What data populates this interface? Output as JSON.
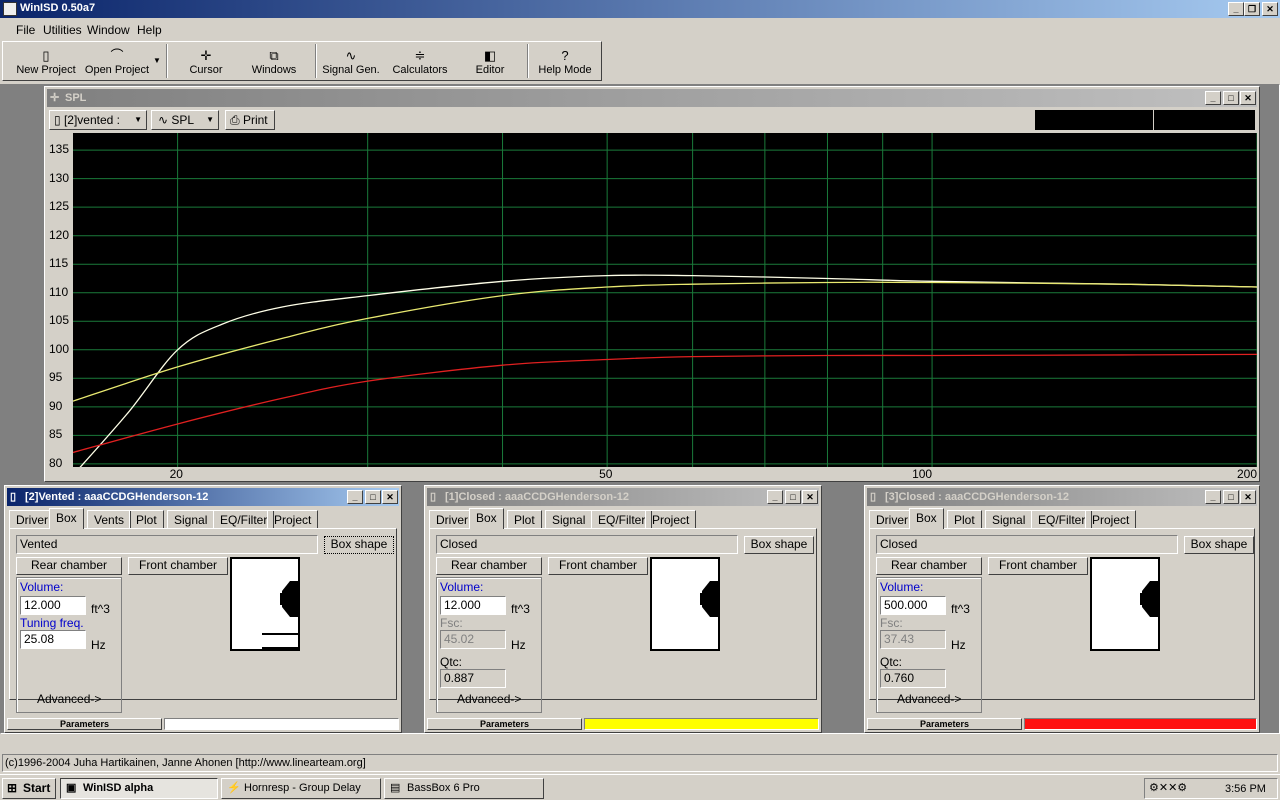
{
  "app": {
    "title": "WinISD 0.50a7"
  },
  "menu": [
    "File",
    "Utilities",
    "Window",
    "Help"
  ],
  "toolbar": [
    {
      "label": "New Project",
      "icon": "new-project-icon"
    },
    {
      "label": "Open Project",
      "icon": "open-project-icon"
    },
    {
      "label": "Cursor",
      "icon": "cursor-icon"
    },
    {
      "label": "Windows",
      "icon": "windows-icon"
    },
    {
      "label": "Signal Gen.",
      "icon": "signal-gen-icon"
    },
    {
      "label": "Calculators",
      "icon": "calculators-icon"
    },
    {
      "label": "Editor",
      "icon": "editor-icon"
    },
    {
      "label": "Help Mode",
      "icon": "help-mode-icon"
    }
  ],
  "spl": {
    "title": "SPL",
    "project_select": "[2]vented :",
    "graph_select": "SPL",
    "print_label": "Print",
    "chart_data": {
      "type": "line",
      "xscale": "log",
      "xlim": [
        16,
        200
      ],
      "ylim": [
        77,
        138
      ],
      "xticks": [
        20,
        50,
        100,
        200
      ],
      "yticks": [
        80,
        85,
        90,
        95,
        100,
        105,
        110,
        115,
        120,
        125,
        130,
        135
      ],
      "grid": true,
      "series": [
        {
          "color": "#ffffe8",
          "x": [
            16,
            18,
            20,
            22,
            25,
            30,
            40,
            50,
            60,
            80,
            100,
            150,
            200
          ],
          "y": [
            78,
            89,
            100,
            104.5,
            107.5,
            109.5,
            112,
            113,
            113,
            112.5,
            112,
            111.5,
            111
          ]
        },
        {
          "color": "#e8e870",
          "x": [
            16,
            20,
            25,
            30,
            40,
            50,
            60,
            80,
            100,
            150,
            200
          ],
          "y": [
            91,
            97,
            102,
            105.5,
            109.5,
            111,
            111.5,
            111.8,
            111.8,
            111.5,
            111
          ]
        },
        {
          "color": "#e02020",
          "x": [
            16,
            20,
            25,
            30,
            40,
            50,
            60,
            80,
            100,
            150,
            200
          ],
          "y": [
            82,
            87,
            91.5,
            94.5,
            97.3,
            98.3,
            98.8,
            99,
            99,
            99.1,
            99.2
          ]
        }
      ]
    }
  },
  "windows": [
    {
      "title": "[2]Vented : aaaCCDGHenderson-12",
      "active": true,
      "tabs": [
        "Driver",
        "Box",
        "Vents",
        "Plot",
        "Signal",
        "EQ/Filter",
        "Project"
      ],
      "selected_tab": "Box",
      "box_type": "Vented",
      "box_shape": "Box shape",
      "rear": "Rear chamber",
      "front": "Front chamber",
      "volume_label": "Volume:",
      "volume": "12.000",
      "volume_unit": "ft^3",
      "f_label": "Tuning freq.",
      "f_value": "25.08",
      "f_unit": "Hz",
      "advanced": "Advanced->",
      "status": "Parameters",
      "color": "#ffffff",
      "vented": true
    },
    {
      "title": "[1]Closed : aaaCCDGHenderson-12",
      "active": false,
      "tabs": [
        "Driver",
        "Box",
        "Plot",
        "Signal",
        "EQ/Filter",
        "Project"
      ],
      "selected_tab": "Box",
      "box_type": "Closed",
      "box_shape": "Box shape",
      "rear": "Rear chamber",
      "front": "Front chamber",
      "volume_label": "Volume:",
      "volume": "12.000",
      "volume_unit": "ft^3",
      "f_label": "Fsc:",
      "f_value": "45.02",
      "f_unit": "Hz",
      "q_label": "Qtc:",
      "q_value": "0.887",
      "advanced": "Advanced->",
      "status": "Parameters",
      "color": "#ffff00",
      "vented": false
    },
    {
      "title": "[3]Closed : aaaCCDGHenderson-12",
      "active": false,
      "tabs": [
        "Driver",
        "Box",
        "Plot",
        "Signal",
        "EQ/Filter",
        "Project"
      ],
      "selected_tab": "Box",
      "box_type": "Closed",
      "box_shape": "Box shape",
      "rear": "Rear chamber",
      "front": "Front chamber",
      "volume_label": "Volume:",
      "volume": "500.000",
      "volume_unit": "ft^3",
      "f_label": "Fsc:",
      "f_value": "37.43",
      "f_unit": "Hz",
      "q_label": "Qtc:",
      "q_value": "0.760",
      "advanced": "Advanced->",
      "status": "Parameters",
      "color": "#ff1010",
      "vented": false
    }
  ],
  "copyright": "(c)1996-2004 Juha Hartikainen, Janne Ahonen [http://www.linearteam.org]",
  "taskbar": {
    "start": "Start",
    "items": [
      "WinISD alpha",
      "Hornresp - Group Delay",
      "BassBox 6 Pro"
    ],
    "clock": "3:56 PM"
  }
}
